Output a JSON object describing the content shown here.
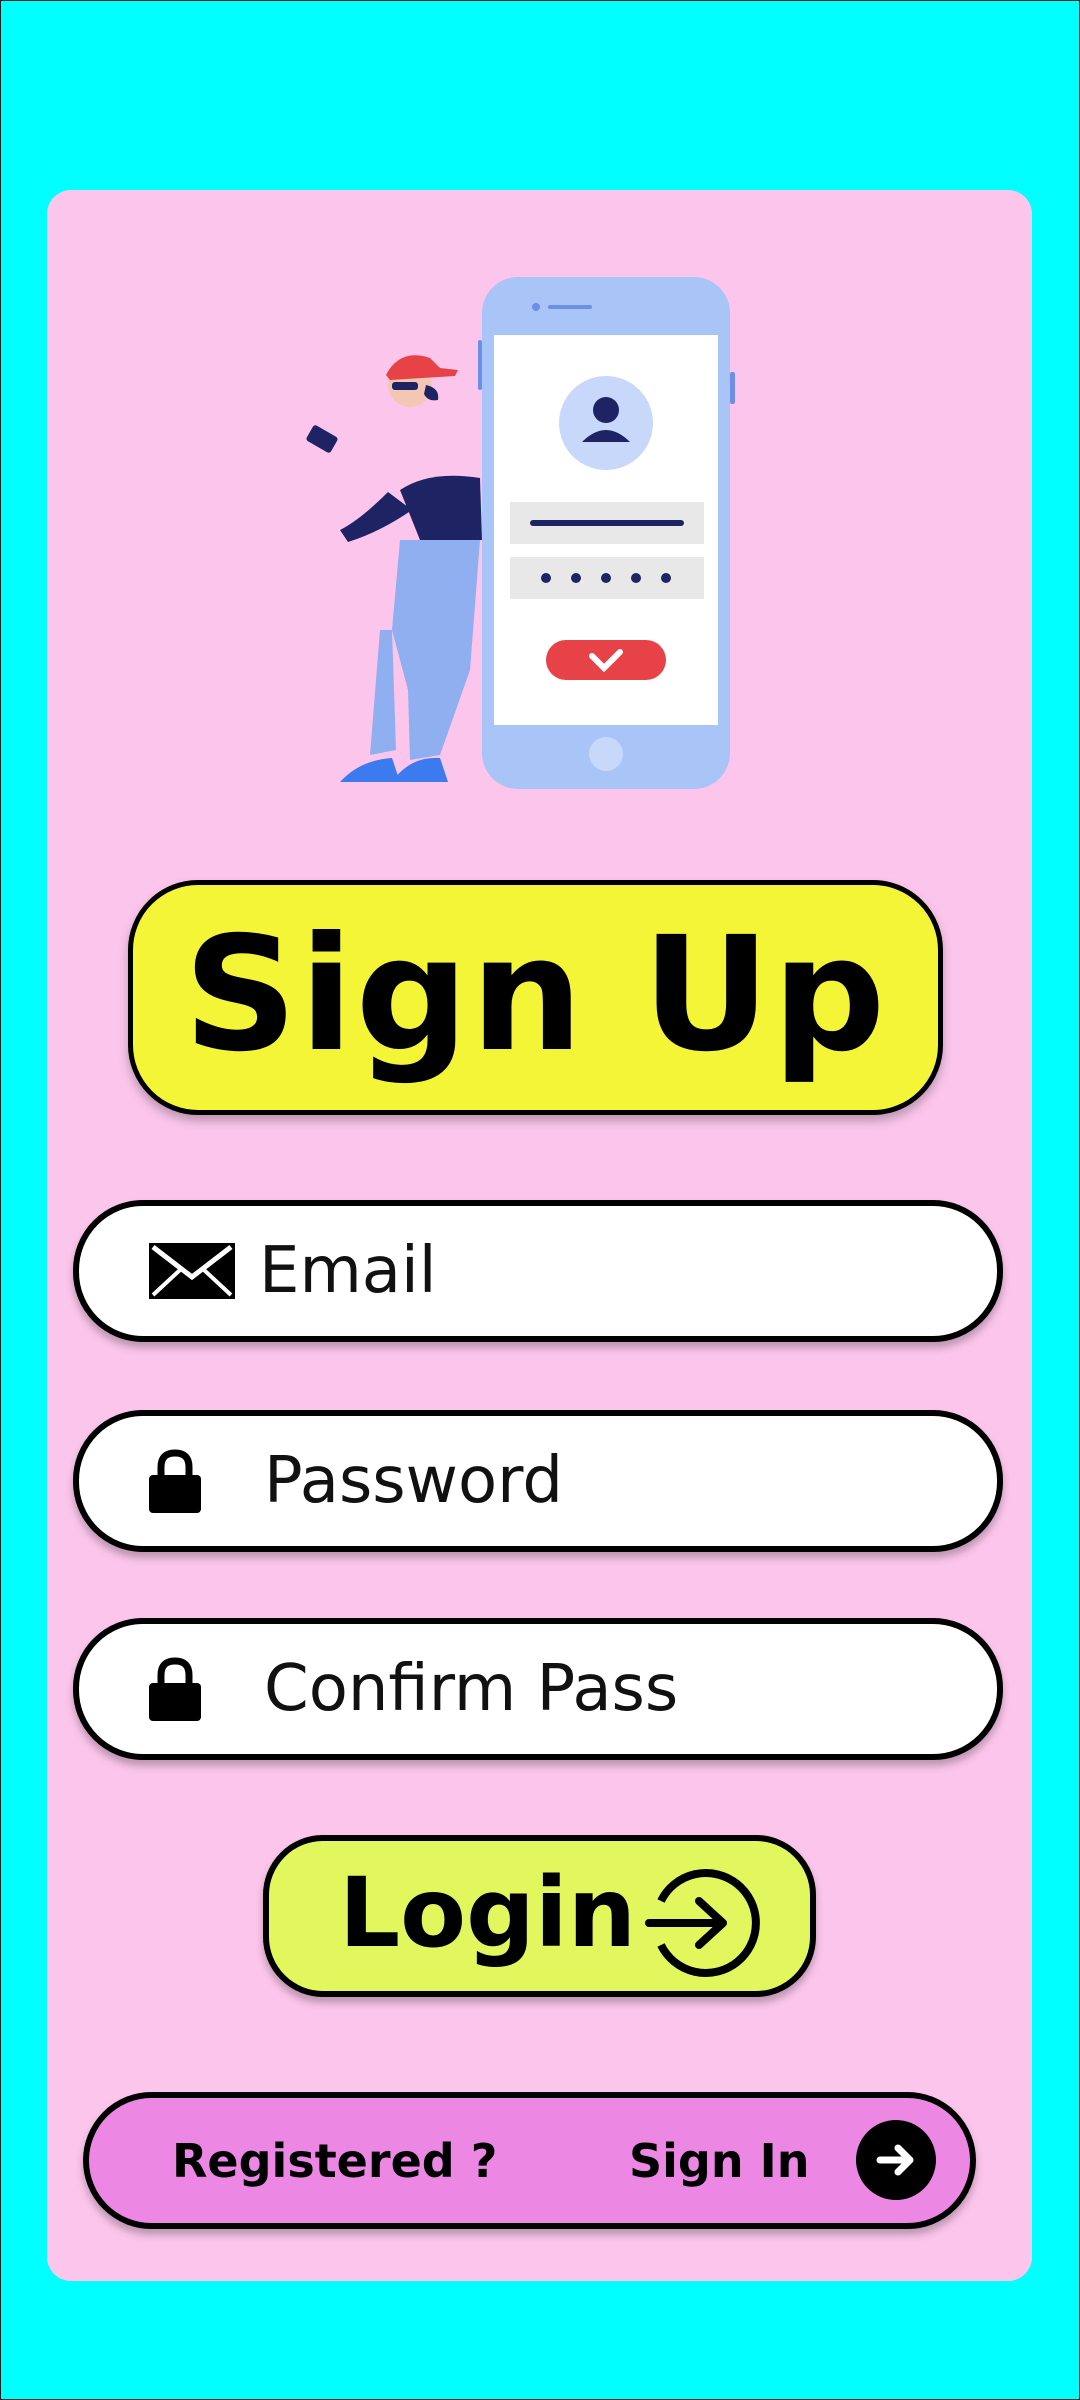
{
  "title": "Sign Up",
  "form": {
    "email_placeholder": "Email",
    "password_placeholder": "Password",
    "confirm_placeholder": "Confirm Pass"
  },
  "login_button": {
    "label": "Login",
    "icon": "arrow-circle-right-icon"
  },
  "register_bar": {
    "question": "Registered ?",
    "sign_in_label": "Sign In",
    "icon": "arrow-right-icon"
  },
  "colors": {
    "background": "#00FFFF",
    "card": "#FCC6EC",
    "title_pill": "#F3F536",
    "login_button": "#E2F75E",
    "register_bar": "#EC88E4"
  }
}
